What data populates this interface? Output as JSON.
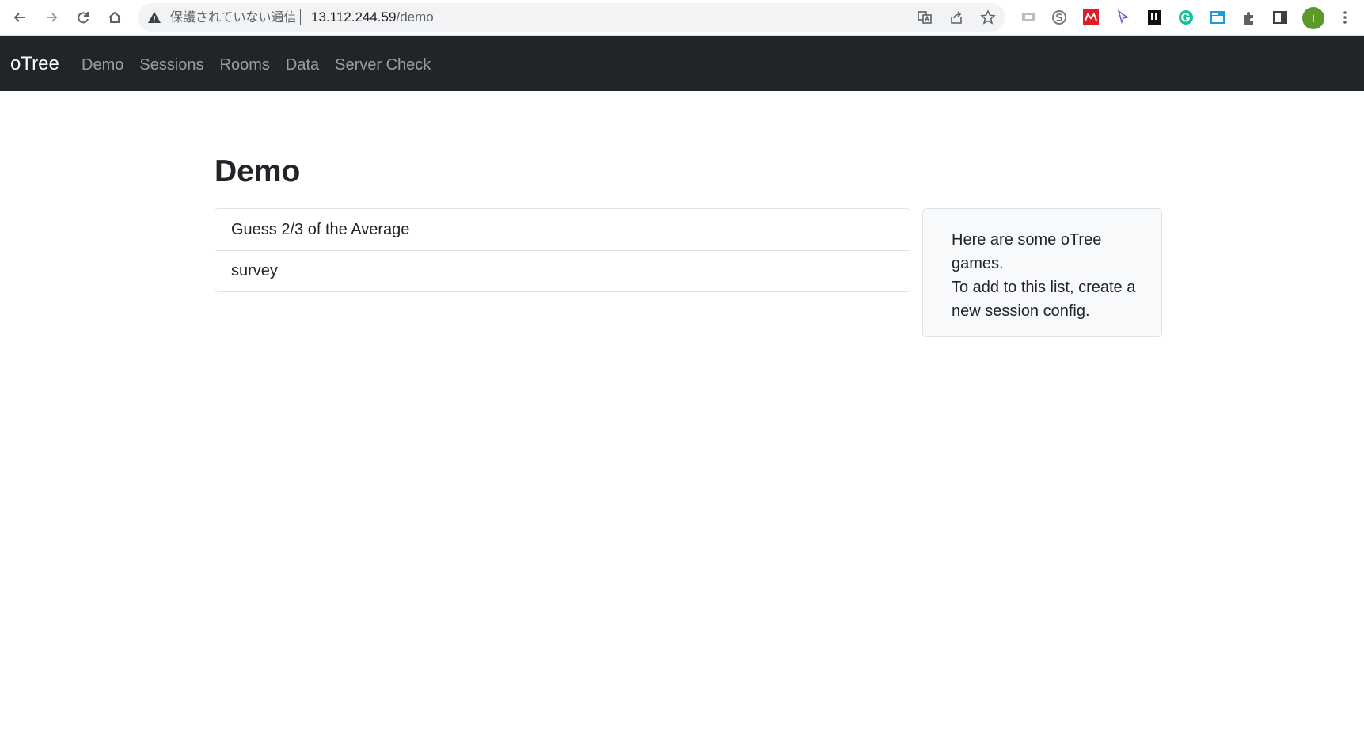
{
  "browser": {
    "security_label": "保護されていない通信",
    "url_host": "13.112.244.59",
    "url_path": "/demo",
    "avatar_letter": "I"
  },
  "navbar": {
    "brand": "oTree",
    "links": [
      "Demo",
      "Sessions",
      "Rooms",
      "Data",
      "Server Check"
    ]
  },
  "main": {
    "title": "Demo",
    "items": [
      "Guess 2/3 of the Average",
      "survey"
    ],
    "info": {
      "line1": "Here are some oTree games.",
      "line2": "To add to this list, create a new session config."
    }
  }
}
